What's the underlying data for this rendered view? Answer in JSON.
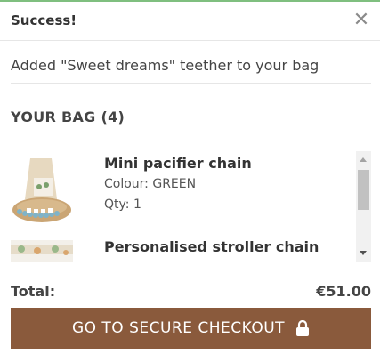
{
  "header": {
    "title": "Success!",
    "close_icon": "close-icon"
  },
  "message": "Added \"Sweet dreams\" teether to your bag",
  "bag": {
    "title": "YOUR BAG (4)",
    "items": [
      {
        "name": "Mini pacifier chain",
        "colour": "Colour: GREEN",
        "qty": "Qty: 1"
      },
      {
        "name": "Personalised stroller chain"
      }
    ]
  },
  "total": {
    "label": "Total:",
    "value": "€51.00"
  },
  "checkout": {
    "label": "GO TO SECURE CHECKOUT",
    "icon": "lock-icon"
  },
  "colors": {
    "accent": "#8a5a3c",
    "success_line": "#7fbf7f"
  }
}
